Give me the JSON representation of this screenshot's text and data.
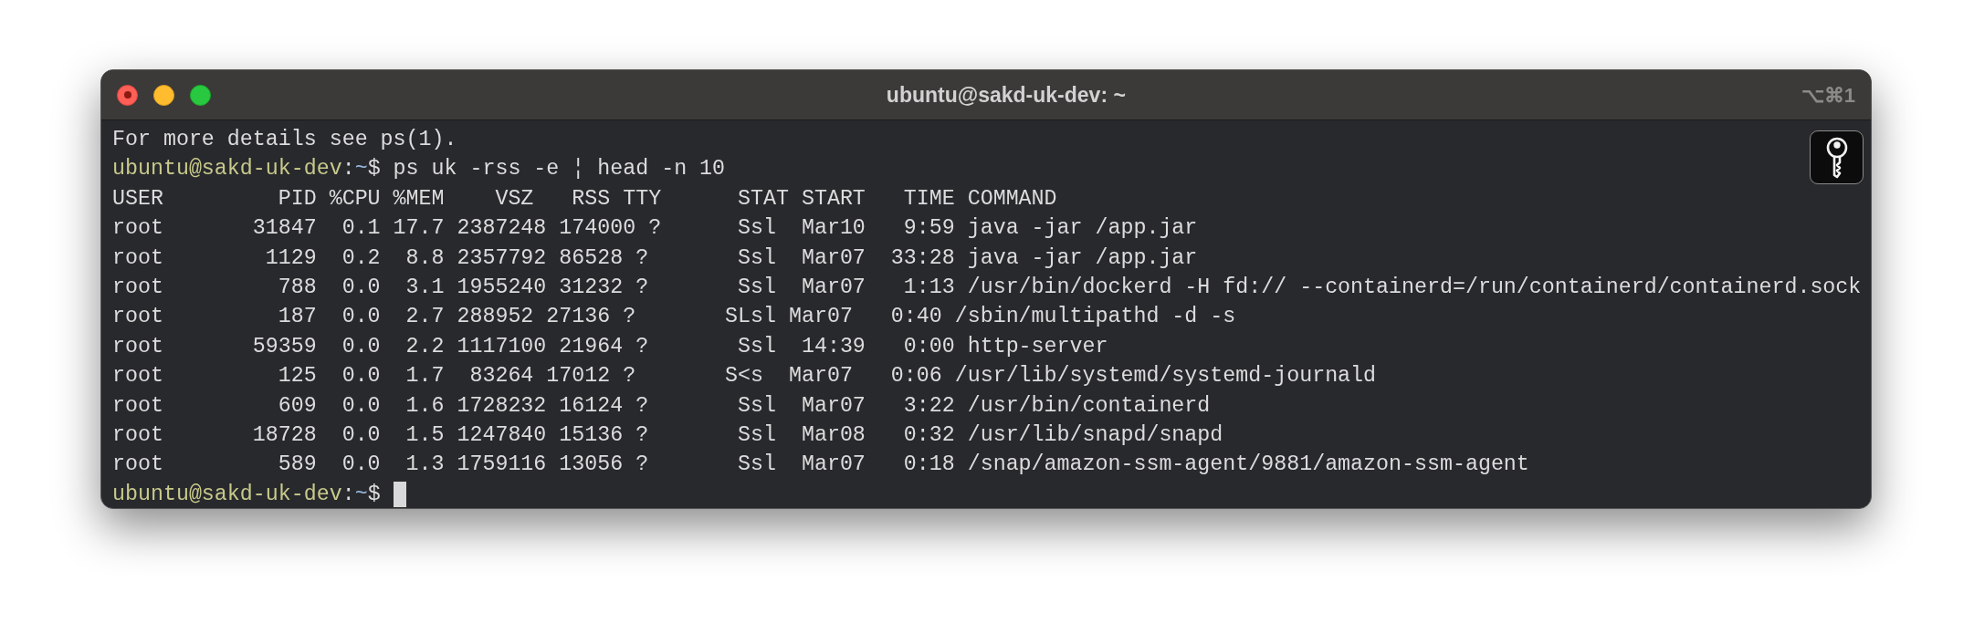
{
  "window": {
    "title": "ubuntu@sakd-uk-dev: ~",
    "shortcut": "⌥⌘1"
  },
  "lines": [
    {
      "kind": "output",
      "text": "For more details see ps(1)."
    },
    {
      "kind": "prompt",
      "host": "ubuntu@sakd-uk-dev",
      "sep": ":",
      "path": "~",
      "symbol": "$",
      "command": "ps uk -rss -e ¦ head -n 10",
      "cursor": false
    },
    {
      "kind": "output",
      "text": "USER         PID %CPU %MEM    VSZ   RSS TTY      STAT START   TIME COMMAND"
    },
    {
      "kind": "output",
      "text": "root       31847  0.1 17.7 2387248 174000 ?      Ssl  Mar10   9:59 java -jar /app.jar"
    },
    {
      "kind": "output",
      "text": "root        1129  0.2  8.8 2357792 86528 ?       Ssl  Mar07  33:28 java -jar /app.jar"
    },
    {
      "kind": "output",
      "text": "root         788  0.0  3.1 1955240 31232 ?       Ssl  Mar07   1:13 /usr/bin/dockerd -H fd:// --containerd=/run/containerd/containerd.sock"
    },
    {
      "kind": "output",
      "text": "root         187  0.0  2.7 288952 27136 ?       SLsl Mar07   0:40 /sbin/multipathd -d -s"
    },
    {
      "kind": "output",
      "text": "root       59359  0.0  2.2 1117100 21964 ?       Ssl  14:39   0:00 http-server"
    },
    {
      "kind": "output",
      "text": "root         125  0.0  1.7  83264 17012 ?       S<s  Mar07   0:06 /usr/lib/systemd/systemd-journald"
    },
    {
      "kind": "output",
      "text": "root         609  0.0  1.6 1728232 16124 ?       Ssl  Mar07   3:22 /usr/bin/containerd"
    },
    {
      "kind": "output",
      "text": "root       18728  0.0  1.5 1247840 15136 ?       Ssl  Mar08   0:32 /usr/lib/snapd/snapd"
    },
    {
      "kind": "output",
      "text": "root         589  0.0  1.3 1759116 13056 ?       Ssl  Mar07   0:18 /snap/amazon-ssm-agent/9881/amazon-ssm-agent"
    },
    {
      "kind": "prompt",
      "host": "ubuntu@sakd-uk-dev",
      "sep": ":",
      "path": "~",
      "symbol": "$",
      "cursor": true
    }
  ]
}
